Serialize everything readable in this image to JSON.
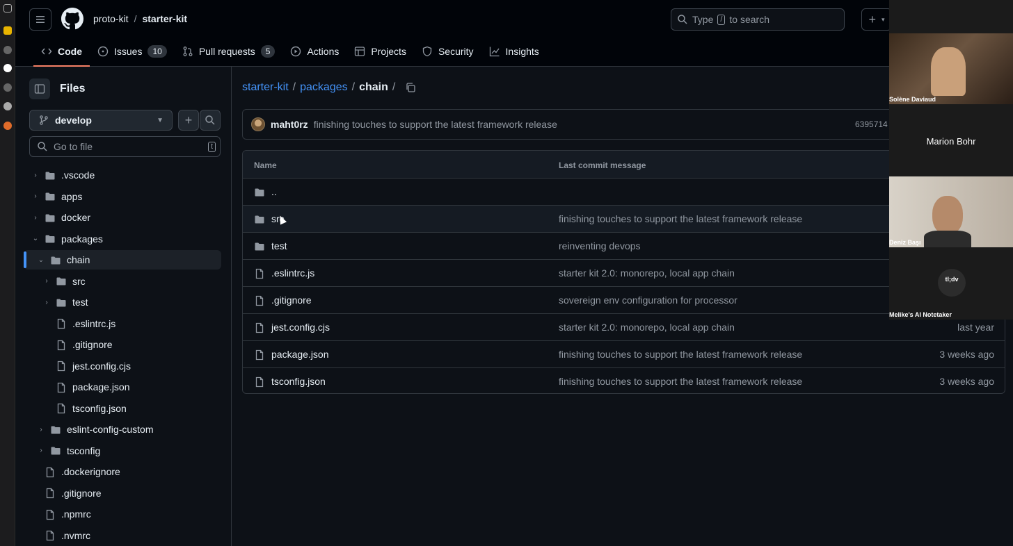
{
  "header": {
    "owner": "proto-kit",
    "separator": "/",
    "repo": "starter-kit",
    "search_prefix": "Type",
    "search_key": "/",
    "search_suffix": "to search"
  },
  "tabs": [
    {
      "label": "Code",
      "icon": "code-icon"
    },
    {
      "label": "Issues",
      "icon": "issue-icon",
      "count": "10"
    },
    {
      "label": "Pull requests",
      "icon": "pull-request-icon",
      "count": "5"
    },
    {
      "label": "Actions",
      "icon": "play-icon"
    },
    {
      "label": "Projects",
      "icon": "table-icon"
    },
    {
      "label": "Security",
      "icon": "shield-icon"
    },
    {
      "label": "Insights",
      "icon": "graph-icon"
    }
  ],
  "sidebar": {
    "title": "Files",
    "branch": "develop",
    "goto_placeholder": "Go to file",
    "goto_key": "t",
    "tree": [
      {
        "label": ".vscode",
        "type": "folder",
        "chevron": "›"
      },
      {
        "label": "apps",
        "type": "folder",
        "chevron": "›"
      },
      {
        "label": "docker",
        "type": "folder",
        "chevron": "›"
      },
      {
        "label": "packages",
        "type": "folder",
        "chevron": "⌄"
      },
      {
        "label": "chain",
        "type": "folder",
        "chevron": "⌄"
      },
      {
        "label": "src",
        "type": "folder",
        "chevron": "›"
      },
      {
        "label": "test",
        "type": "folder",
        "chevron": "›"
      },
      {
        "label": ".eslintrc.js",
        "type": "file"
      },
      {
        "label": ".gitignore",
        "type": "file"
      },
      {
        "label": "jest.config.cjs",
        "type": "file"
      },
      {
        "label": "package.json",
        "type": "file"
      },
      {
        "label": "tsconfig.json",
        "type": "file"
      },
      {
        "label": "eslint-config-custom",
        "type": "folder",
        "chevron": "›"
      },
      {
        "label": "tsconfig",
        "type": "folder",
        "chevron": "›"
      },
      {
        "label": ".dockerignore",
        "type": "file"
      },
      {
        "label": ".gitignore",
        "type": "file"
      },
      {
        "label": ".npmrc",
        "type": "file"
      },
      {
        "label": ".nvmrc",
        "type": "file"
      }
    ]
  },
  "path": {
    "parts": [
      "starter-kit",
      "packages"
    ],
    "current": "chain",
    "sep": "/"
  },
  "commit": {
    "author": "maht0rz",
    "message": "finishing touches to support the latest framework release",
    "hash": "6395714"
  },
  "table": {
    "col_name": "Name",
    "col_message": "Last commit message",
    "rows": [
      {
        "name": "..",
        "type": "folder",
        "message": "",
        "date": ""
      },
      {
        "name": "src",
        "type": "folder",
        "message": "finishing touches to support the latest framework release",
        "date": ""
      },
      {
        "name": "test",
        "type": "folder",
        "message": "reinventing devops",
        "date": ""
      },
      {
        "name": ".eslintrc.js",
        "type": "file",
        "message": "starter kit 2.0: monorepo, local app chain",
        "date": ""
      },
      {
        "name": ".gitignore",
        "type": "file",
        "message": "sovereign env configuration for processor",
        "date": ""
      },
      {
        "name": "jest.config.cjs",
        "type": "file",
        "message": "starter kit 2.0: monorepo, local app chain",
        "date": "last year"
      },
      {
        "name": "package.json",
        "type": "file",
        "message": "finishing touches to support the latest framework release",
        "date": "3 weeks ago"
      },
      {
        "name": "tsconfig.json",
        "type": "file",
        "message": "finishing touches to support the latest framework release",
        "date": "3 weeks ago"
      }
    ]
  },
  "call": {
    "participants": [
      {
        "name": "Solène Daviaud"
      },
      {
        "name": "Marion Bohr"
      },
      {
        "name": "Deniz Başı"
      },
      {
        "name": "Melike's AI Notetaker"
      }
    ],
    "tldv_logo": "tl;dv"
  },
  "colors": {
    "accent_link": "#4493f8",
    "tab_underline": "#f78166",
    "background": "#0d1117"
  }
}
